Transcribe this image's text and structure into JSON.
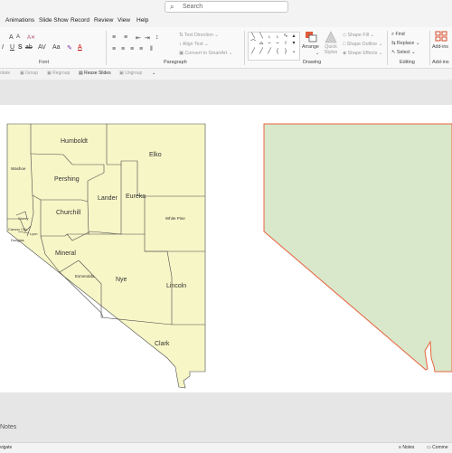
{
  "search": {
    "placeholder": "Search"
  },
  "menu": [
    "Animations",
    "Slide Show",
    "Record",
    "Review",
    "View",
    "Help"
  ],
  "ribbon": {
    "groups": {
      "font": "Font",
      "paragraph": "Paragraph",
      "drawing": "Drawing",
      "editing": "Editing",
      "addins": "Add-ins"
    },
    "paragraph": {
      "text_direction": "Text Direction",
      "align_text": "Align Text",
      "convert_smartart": "Convert to SmartArt"
    },
    "drawing": {
      "arrange": "Arrange",
      "quick_styles": "Quick Styles",
      "shape_fill": "Shape Fill",
      "shape_outline": "Shape Outline",
      "shape_effects": "Shape Effects"
    },
    "editing": {
      "find": "Find",
      "replace": "Replace",
      "select": "Select"
    },
    "addins": {
      "label": "Add-ins"
    }
  },
  "qat": {
    "rotate": "otate",
    "group": "Group",
    "regroup": "Regroup",
    "reuse_slides": "Reuse Slides",
    "ungroup": "Ungroup"
  },
  "slide": {
    "counties": {
      "humboldt": "Humboldt",
      "elko": "Elko",
      "washoe": "Washoe",
      "pershing": "Pershing",
      "lander": "Lander",
      "eureka": "Eureka",
      "churchill": "Churchill",
      "white_pine": "White Pine",
      "storey": "Storey",
      "carson_city": "Carson City",
      "lyon": "Lyon",
      "douglas": "Douglas",
      "mineral": "Mineral",
      "esmeralda": "Esmeralda",
      "nye": "Nye",
      "lincoln": "Lincoln",
      "clark": "Clark"
    }
  },
  "footer": {
    "notes_pane": "Notes",
    "navigate": "vigate",
    "notes_button": "Notes",
    "comments_button": "Comme"
  },
  "colors": {
    "county_fill": "#f6f6c7",
    "state_fill": "#d9e7cb",
    "state_outline": "#e5653f",
    "county_stroke": "#4a4a4a"
  }
}
